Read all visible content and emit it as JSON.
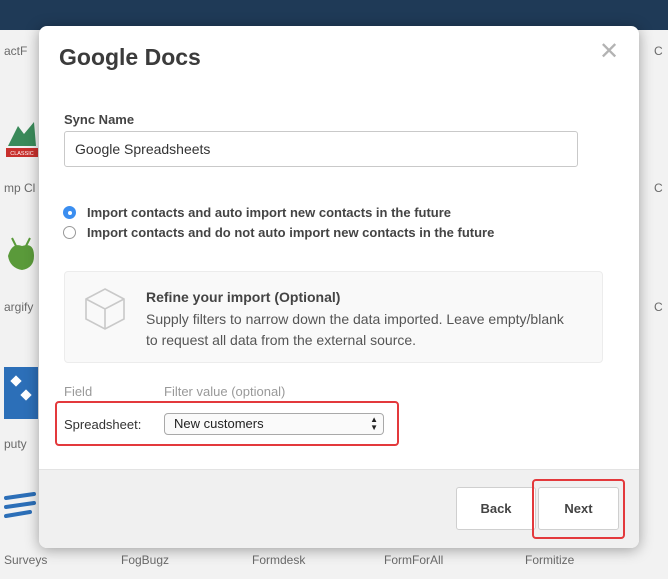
{
  "background": {
    "labels": {
      "contactf": "actF",
      "mp_cl": "mp Cl",
      "argify": "argify",
      "puty": "puty",
      "surveys": "Surveys",
      "fogbugz": "FogBugz",
      "formdesk": "Formdesk",
      "formforall": "FormForAll",
      "formitize": "Formitize",
      "classic": "CLASSIC",
      "right_c1": "C",
      "right_c2": "C",
      "right_c3": "C"
    }
  },
  "modal": {
    "title": "Google Docs",
    "close_glyph": "✕",
    "sync_name_label": "Sync Name",
    "sync_name_value": "Google Spreadsheets",
    "import_options": [
      {
        "label": "Import contacts and auto import new contacts in the future",
        "checked": true
      },
      {
        "label": "Import contacts and do not auto import new contacts in the future",
        "checked": false
      }
    ],
    "refine": {
      "title": "Refine your import (Optional)",
      "description": "Supply filters to narrow down the data imported. Leave empty/blank to request all data from the external source."
    },
    "filters": {
      "field_header": "Field",
      "value_header": "Filter value (optional)",
      "spreadsheet_label": "Spreadsheet:",
      "spreadsheet_value": "New customers"
    },
    "buttons": {
      "back": "Back",
      "next": "Next"
    }
  },
  "colors": {
    "accent_blue": "#3b8ef0",
    "highlight_red": "#e3393c",
    "topbar": "#1f3a57"
  }
}
